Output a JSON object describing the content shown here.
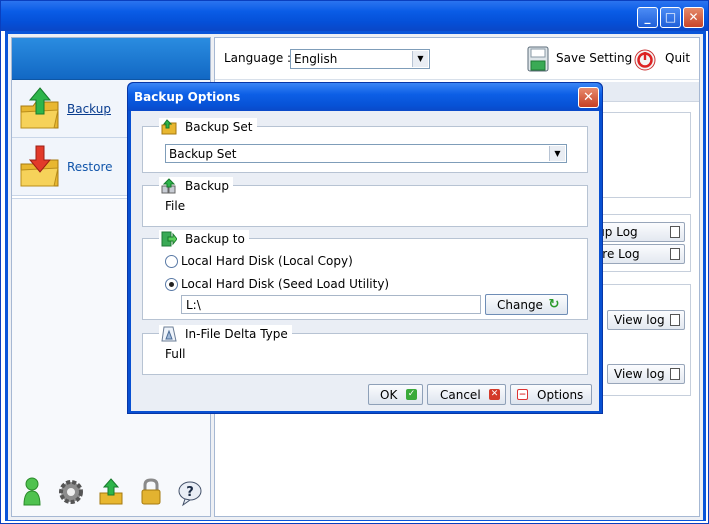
{
  "window": {
    "controls": {
      "minimize": "_",
      "maximize": "□",
      "close": "✕"
    }
  },
  "sidebar": {
    "items": [
      {
        "label": "Backup",
        "icon": "backup-folder-icon",
        "active": true
      },
      {
        "label": "Restore",
        "icon": "restore-folder-icon",
        "active": false
      }
    ],
    "bottom_icons": [
      "user-icon",
      "settings-gear-icon",
      "upload-icon",
      "lock-icon",
      "help-icon"
    ]
  },
  "toolbar": {
    "language_label": "Language :",
    "language_value": "English",
    "save_label": "Save Setting",
    "quit_label": "Quit"
  },
  "background_panel": {
    "backup_log_label": "ckup Log",
    "restore_log_label": "store Log",
    "view_log_1": "View log",
    "view_log_2": "View log"
  },
  "dialog": {
    "title": "Backup Options",
    "close": "✕",
    "backup_set": {
      "legend": "Backup Set",
      "value": "Backup Set"
    },
    "backup": {
      "legend": "Backup",
      "value": "File"
    },
    "backup_to": {
      "legend": "Backup to",
      "option_local_copy": "Local Hard Disk (Local Copy)",
      "option_seed_load": "Local Hard Disk (Seed Load Utility)",
      "selected": "option_seed_load",
      "path": "L:\\",
      "change_label": "Change"
    },
    "in_file_delta": {
      "legend": "In-File Delta Type",
      "value": "Full"
    },
    "buttons": {
      "ok": "OK",
      "cancel": "Cancel",
      "options": "Options"
    }
  },
  "colors": {
    "title_blue": "#0a5ce6",
    "accent_green": "#2a9a2a",
    "close_red": "#c8452a"
  }
}
